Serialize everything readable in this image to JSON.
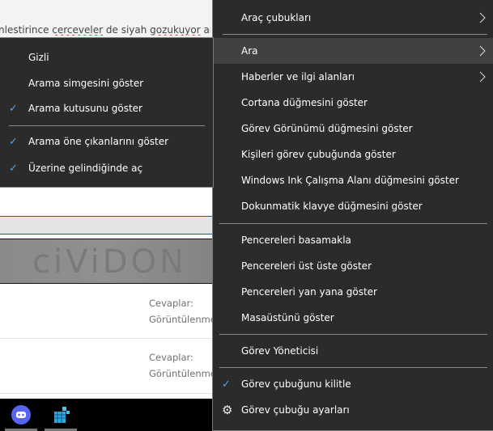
{
  "background": {
    "snippet_text": "nlestirince ",
    "snippet_misspelled": [
      "cerceveler",
      "gozukuyor"
    ],
    "snippet_rest": [
      "de siyah",
      "ama gor"
    ],
    "banner_text": "ciViDON",
    "rows": [
      {
        "replies_label": "Cevaplar:",
        "views_label": "Görüntülenme"
      },
      {
        "replies_label": "Cevaplar:",
        "views_label": "Görüntülenme"
      }
    ]
  },
  "taskbar": {
    "apps": [
      {
        "name": "Discord",
        "color": "#5865f2"
      },
      {
        "name": "Registry",
        "color": "#2fa8e0"
      }
    ]
  },
  "context_menu": {
    "items": [
      {
        "label": "Araç çubukları",
        "submenu": true
      },
      {
        "label": "Ara",
        "submenu": true,
        "highlighted": true
      },
      {
        "label": "Haberler ve ilgi alanları",
        "submenu": true
      },
      {
        "label": "Cortana düğmesini göster"
      },
      {
        "label": "Görev Görünümü düğmesini göster"
      },
      {
        "label": "Kişileri görev çubuğunda göster"
      },
      {
        "label": "Windows Ink Çalışma Alanı düğmesini göster"
      },
      {
        "label": "Dokunmatik klavye düğmesini göster"
      },
      {
        "label": "Pencereleri basamakla"
      },
      {
        "label": "Pencereleri üst üste göster"
      },
      {
        "label": "Pencereleri yan yana göster"
      },
      {
        "label": "Masaüstünü göster"
      },
      {
        "label": "Görev Yöneticisi"
      },
      {
        "label": "Görev çubuğunu kilitle",
        "checked": true
      },
      {
        "label": "Görev çubuğu ayarları",
        "icon": "gear-icon"
      }
    ]
  },
  "search_submenu": {
    "items": [
      {
        "label": "Gizli"
      },
      {
        "label": "Arama simgesini göster"
      },
      {
        "label": "Arama kutusunu göster",
        "checked": true
      },
      {
        "label": "Arama öne çıkanlarını göster",
        "checked": true
      },
      {
        "label": "Üzerine gelindiğinde aç",
        "checked": true
      }
    ]
  },
  "colors": {
    "menu_bg": "#2b2b2b",
    "menu_hover": "#414141",
    "check": "#5aa0e8"
  }
}
